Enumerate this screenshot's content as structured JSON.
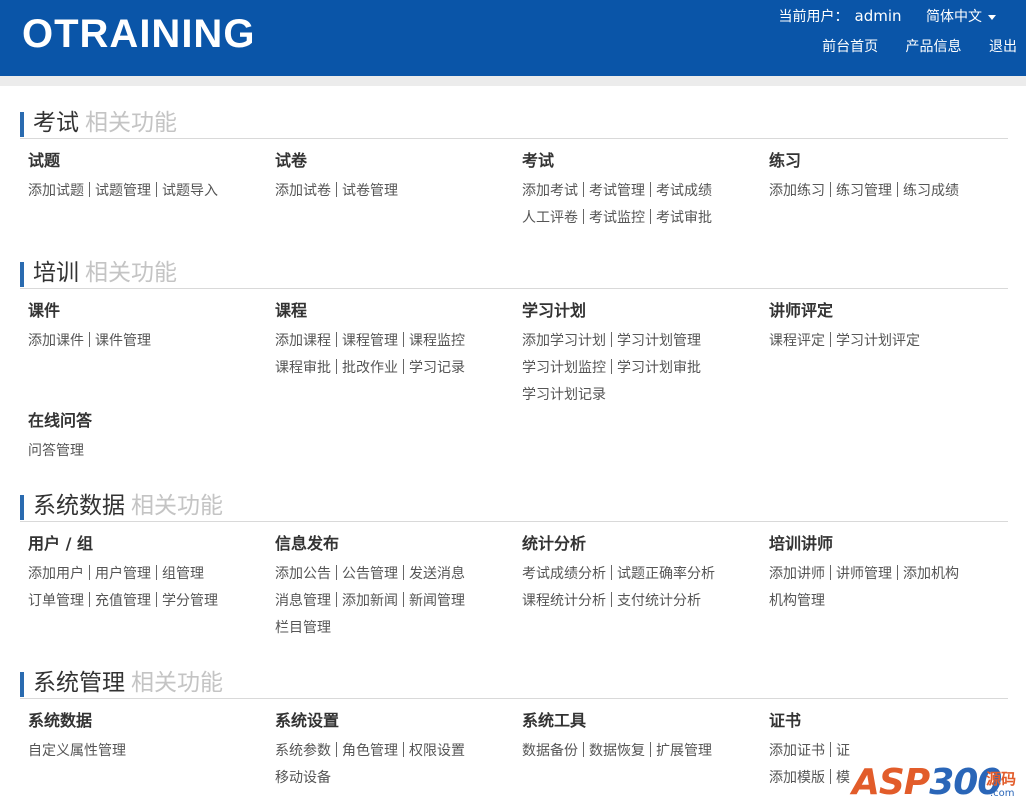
{
  "header": {
    "logo": "OTRAINING",
    "current_user_label": "当前用户：",
    "username": "admin",
    "language": "简体中文",
    "nav": [
      "前台首页",
      "产品信息",
      "退出"
    ]
  },
  "sections": [
    {
      "title": "考试",
      "subtitle": "相关功能",
      "groups": [
        {
          "title": "试题",
          "rows": [
            [
              "添加试题",
              "试题管理",
              "试题导入"
            ]
          ]
        },
        {
          "title": "试卷",
          "rows": [
            [
              "添加试卷",
              "试卷管理"
            ]
          ]
        },
        {
          "title": "考试",
          "rows": [
            [
              "添加考试",
              "考试管理",
              "考试成绩"
            ],
            [
              "人工评卷",
              "考试监控",
              "考试审批"
            ]
          ]
        },
        {
          "title": "练习",
          "rows": [
            [
              "添加练习",
              "练习管理",
              "练习成绩"
            ]
          ]
        }
      ]
    },
    {
      "title": "培训",
      "subtitle": "相关功能",
      "groups": [
        {
          "title": "课件",
          "rows": [
            [
              "添加课件",
              "课件管理"
            ]
          ]
        },
        {
          "title": "课程",
          "rows": [
            [
              "添加课程",
              "课程管理",
              "课程监控"
            ],
            [
              "课程审批",
              "批改作业",
              "学习记录"
            ]
          ]
        },
        {
          "title": "学习计划",
          "rows": [
            [
              "添加学习计划",
              "学习计划管理"
            ],
            [
              "学习计划监控",
              "学习计划审批"
            ],
            [
              "学习计划记录"
            ]
          ]
        },
        {
          "title": "讲师评定",
          "rows": [
            [
              "课程评定",
              "学习计划评定"
            ]
          ]
        },
        {
          "title": "在线问答",
          "rows": [
            [
              "问答管理"
            ]
          ]
        }
      ]
    },
    {
      "title": "系统数据",
      "subtitle": "相关功能",
      "groups": [
        {
          "title": "用户 / 组",
          "rows": [
            [
              "添加用户",
              "用户管理",
              "组管理"
            ],
            [
              "订单管理",
              "充值管理",
              "学分管理"
            ]
          ]
        },
        {
          "title": "信息发布",
          "rows": [
            [
              "添加公告",
              "公告管理",
              "发送消息"
            ],
            [
              "消息管理",
              "添加新闻",
              "新闻管理"
            ],
            [
              "栏目管理"
            ]
          ]
        },
        {
          "title": "统计分析",
          "rows": [
            [
              "考试成绩分析",
              "试题正确率分析"
            ],
            [
              "课程统计分析",
              "支付统计分析"
            ]
          ]
        },
        {
          "title": "培训讲师",
          "rows": [
            [
              "添加讲师",
              "讲师管理",
              "添加机构"
            ],
            [
              "机构管理"
            ]
          ]
        }
      ]
    },
    {
      "title": "系统管理",
      "subtitle": "相关功能",
      "groups": [
        {
          "title": "系统数据",
          "rows": [
            [
              "自定义属性管理"
            ]
          ]
        },
        {
          "title": "系统设置",
          "rows": [
            [
              "系统参数",
              "角色管理",
              "权限设置"
            ],
            [
              "移动设备"
            ]
          ]
        },
        {
          "title": "系统工具",
          "rows": [
            [
              "数据备份",
              "数据恢复",
              "扩展管理"
            ]
          ]
        },
        {
          "title": "证书",
          "rows": [
            [
              "添加证书",
              "证"
            ],
            [
              "添加模版",
              "模"
            ]
          ]
        }
      ]
    }
  ],
  "watermark": {
    "text_a": "ASP",
    "text_b": "300",
    "cn": "源码",
    "dot": ".com"
  }
}
